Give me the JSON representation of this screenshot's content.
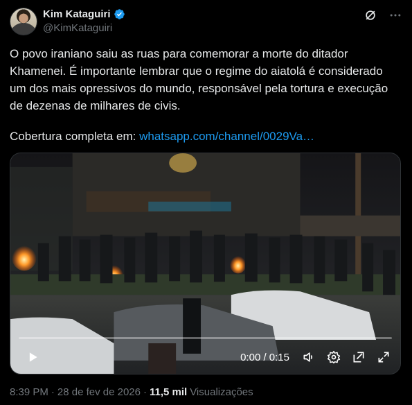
{
  "author": {
    "display_name": "Kim Kataguiri",
    "handle": "@KimKataguiri",
    "verified": true
  },
  "tweet": {
    "text": "O povo iraniano saiu as ruas para comemorar a morte do ditador\nKhamenei. É importante lembrar que o regime do aiatolá é considerado\num dos mais opressivos do mundo, responsável pela tortura e execução\nde dezenas de milhares de civis.",
    "link_prefix": "Cobertura completa em: ",
    "link_text": "whatsapp.com/channel/0029Va…"
  },
  "video": {
    "time": "0:00 / 0:15",
    "progress": 0
  },
  "meta": {
    "time": "8:39 PM",
    "separator1": "·",
    "date": "28 de fev de 2026",
    "separator2": "·",
    "views_count": "11,5 mil",
    "views_label": "Visualizações"
  },
  "icons": {
    "verified": "verified-badge-icon",
    "grok": "grok-icon",
    "more": "more-icon",
    "play": "play-icon",
    "volume": "volume-icon",
    "settings": "settings-icon",
    "pip": "picture-in-picture-icon",
    "fullscreen": "fullscreen-icon"
  },
  "colors": {
    "accent": "#1d9bf0",
    "text": "#e7e9ea",
    "secondary": "#71767b",
    "background": "#000000"
  }
}
